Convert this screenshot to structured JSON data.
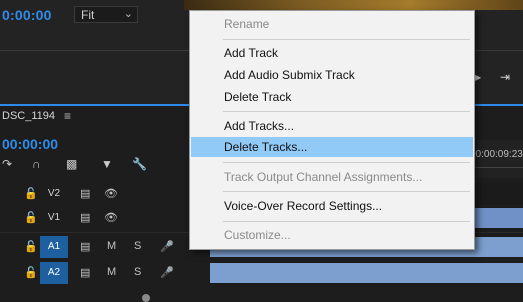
{
  "program_monitor": {
    "timecode": "0:00:00",
    "zoom_select": "Fit"
  },
  "timeline": {
    "sequence_tab": "DSC_1194",
    "timecode": "00:00:00",
    "ruler_time": "00:00:09:23",
    "tracks": [
      {
        "label": "V2",
        "type": "video",
        "active": false
      },
      {
        "label": "V1",
        "type": "video",
        "active": false
      },
      {
        "label": "A1",
        "type": "audio",
        "active": true
      },
      {
        "label": "A2",
        "type": "audio",
        "active": true
      }
    ],
    "audio_buttons": {
      "mute": "M",
      "solo": "S"
    }
  },
  "context_menu": {
    "items": [
      {
        "label": "Rename",
        "enabled": false,
        "highlight": false
      },
      {
        "label": "Add Track",
        "enabled": true,
        "highlight": false
      },
      {
        "label": "Add Audio Submix Track",
        "enabled": true,
        "highlight": false
      },
      {
        "label": "Delete Track",
        "enabled": true,
        "highlight": false
      },
      {
        "label": "Add Tracks...",
        "enabled": true,
        "highlight": false
      },
      {
        "label": "Delete Tracks...",
        "enabled": true,
        "highlight": true
      },
      {
        "label": "Track Output Channel Assignments...",
        "enabled": false,
        "highlight": false
      },
      {
        "label": "Voice-Over Record Settings...",
        "enabled": true,
        "highlight": false
      },
      {
        "label": "Customize...",
        "enabled": false,
        "highlight": false
      }
    ]
  },
  "colors": {
    "accent_blue": "#2d8ceb",
    "menu_highlight": "#91c9f7",
    "track_active": "#1e5f9f",
    "clip_blue": "#6f91c7"
  }
}
